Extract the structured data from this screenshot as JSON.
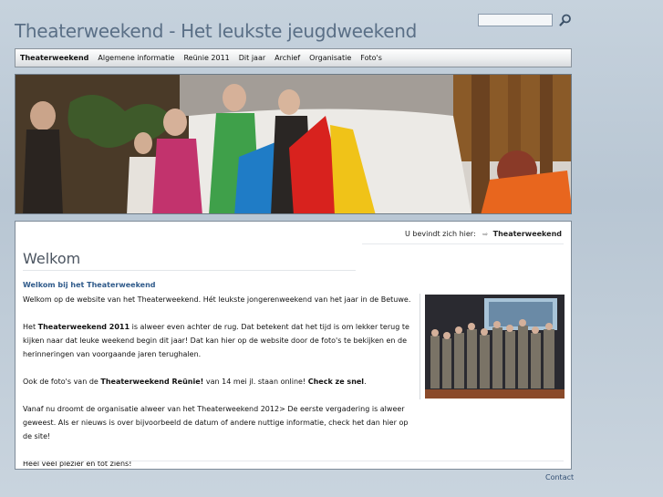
{
  "site": {
    "title": "Theaterweekend - Het leukste jeugdweekend"
  },
  "search": {
    "placeholder": ""
  },
  "nav": {
    "items": [
      {
        "label": "Theaterweekend"
      },
      {
        "label": "Algemene informatie"
      },
      {
        "label": "Reünie 2011"
      },
      {
        "label": "Dit jaar"
      },
      {
        "label": "Archief"
      },
      {
        "label": "Organisatie"
      },
      {
        "label": "Foto's"
      }
    ],
    "active_index": 0
  },
  "breadcrumb": {
    "prefix": "U bevindt zich hier:",
    "current": "Theaterweekend"
  },
  "page": {
    "title": "Welkom",
    "subtitle": "Welkom bij het Theaterweekend",
    "p1": "Welkom op de website van het Theaterweekend. Hét leukste jongerenweekend van het jaar in de Betuwe.",
    "p2_a": "Het ",
    "p2_bold": "Theaterweekend 2011",
    "p2_b": " is alweer even achter de rug. Dat betekent dat het tijd is om lekker terug te kijken naar dat leuke weekend begin dit jaar! Dat kan hier op de website door de foto's te bekijken en de herinneringen van voorgaande jaren terughalen.",
    "p3_a": "Ook de foto's van de ",
    "p3_bold": "Theaterweekend Reünie!",
    "p3_b": " van 14 mei jl. staan online! ",
    "p3_link": "Check ze snel",
    "p3_c": ".",
    "p4": "Vanaf nu droomt de organisatie alweer van het Theaterweekend 2012> De eerste vergadering is alweer geweest. Als er nieuws is over bijvoorbeeld de datum of andere nuttige informatie, check het dan hier op de site!",
    "p5": "Heel veel plezier en tot ziens!"
  },
  "footer": {
    "contact": "Contact"
  },
  "colors": {
    "accent": "#2f5a8a",
    "title": "#5a6f86"
  }
}
